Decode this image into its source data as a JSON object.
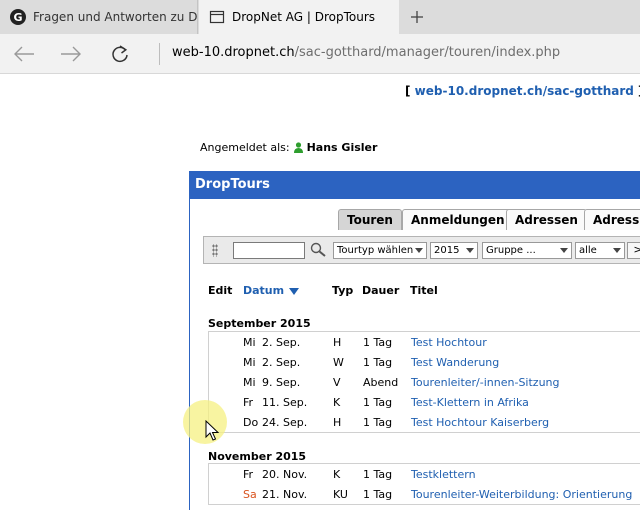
{
  "browser": {
    "tabs": [
      {
        "title": "Fragen und Antworten zu Dr",
        "icon": "google-icon",
        "active": false
      },
      {
        "title": "DropNet AG | DropTours",
        "icon": "page-icon",
        "active": true
      }
    ],
    "address": {
      "host": "web-10.dropnet.ch",
      "path": "/sac-gotthard/manager/touren/index.php"
    }
  },
  "page": {
    "topline": {
      "open": "[ ",
      "link": "web-10.dropnet.ch/sac-gotthard",
      "close": " ] ["
    },
    "login": {
      "label": "Angemeldet als:",
      "user": "Hans Gisler"
    },
    "panel_title": "DropTours",
    "tabs": [
      {
        "label": "Touren",
        "selected": true
      },
      {
        "label": "Anmeldungen",
        "selected": false
      },
      {
        "label": "Adressen",
        "selected": false
      },
      {
        "label": "Adressk",
        "selected": false
      }
    ],
    "toolbar": {
      "search_value": "",
      "tourtyp": "Tourtyp wählen",
      "year": "2015",
      "gruppe": "Gruppe ...",
      "status": "alle",
      "go": ">"
    },
    "columns": {
      "edit": "Edit",
      "datum": "Datum",
      "typ": "Typ",
      "dauer": "Dauer",
      "titel": "Titel"
    },
    "groups": [
      {
        "month": "September 2015",
        "rows": [
          {
            "weekday": "Mi",
            "date": "2. Sep.",
            "typ": "H",
            "dauer": "1 Tag",
            "titel": "Test Hochtour"
          },
          {
            "weekday": "Mi",
            "date": "2. Sep.",
            "typ": "W",
            "dauer": "1 Tag",
            "titel": "Test Wanderung"
          },
          {
            "weekday": "Mi",
            "date": "9. Sep.",
            "typ": "V",
            "dauer": "Abend",
            "titel": "Tourenleiter/-innen-Sitzung"
          },
          {
            "weekday": "Fr",
            "date": "11. Sep.",
            "typ": "K",
            "dauer": "1 Tag",
            "titel": "Test-Klettern in Afrika"
          },
          {
            "weekday": "Do",
            "date": "24. Sep.",
            "typ": "H",
            "dauer": "1 Tag",
            "titel": "Test Hochtour Kaiserberg"
          }
        ]
      },
      {
        "month": "November 2015",
        "rows": [
          {
            "weekday": "Fr",
            "date": "20. Nov.",
            "typ": "K",
            "dauer": "1 Tag",
            "titel": "Testklettern"
          },
          {
            "weekday": "Sa",
            "date": "21. Nov.",
            "typ": "KU",
            "dauer": "1 Tag",
            "titel": "Tourenleiter-Weiterbildung: Orientierung",
            "weekend": true
          }
        ]
      }
    ]
  },
  "colors": {
    "panel_blue": "#2c63c1",
    "link_blue": "#1f5fb0",
    "weekend": "#d9531e",
    "user_green": "#2e9e2e"
  }
}
